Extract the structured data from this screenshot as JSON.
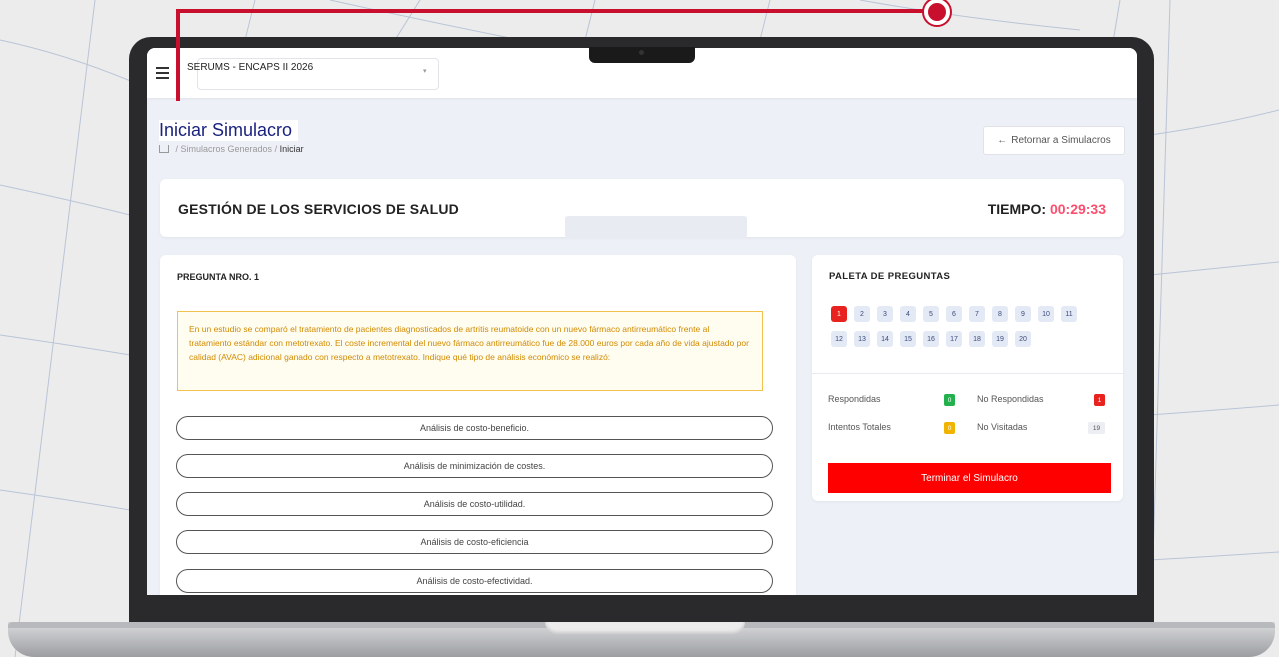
{
  "topbar": {
    "course": "SERUMS - ENCAPS II 2026"
  },
  "header": {
    "title": "Iniciar Simulacro",
    "breadcrumb": [
      "Simulacros Generados",
      "Iniciar"
    ],
    "back_button": "Retornar a Simulacros"
  },
  "exam": {
    "section": "GESTIÓN DE LOS SERVICIOS DE SALUD",
    "timer_label": "TIEMPO:",
    "timer_value": "00:29:33"
  },
  "question": {
    "title": "PREGUNTA NRO. 1",
    "text": "En un estudio se comparó el tratamiento de pacientes diagnosticados de artritis reumatoide con un nuevo fármaco antirreumático frente al tratamiento estándar con metotrexato. El coste incremental del nuevo fármaco antirreumático fue de 28.000 euros por cada año de vida ajustado por calidad (AVAC) adicional ganado con respecto a metotrexato. Indique qué tipo de análisis económico se realizó:",
    "options": [
      "Análisis de costo-beneficio.",
      "Análisis de minimización de costes.",
      "Análisis de costo-utilidad.",
      "Análisis de costo-eficiencia",
      "Análisis de costo-efectividad."
    ]
  },
  "palette": {
    "title": "PALETA DE PREGUNTAS",
    "numbers": [
      "1",
      "2",
      "3",
      "4",
      "5",
      "6",
      "7",
      "8",
      "9",
      "10",
      "11",
      "12",
      "13",
      "14",
      "15",
      "16",
      "17",
      "18",
      "19",
      "20"
    ],
    "current": "1",
    "stats": {
      "answered_label": "Respondidas",
      "answered": "0",
      "unanswered_label": "No Respondidas",
      "unanswered": "1",
      "attempts_label": "Intentos Totales",
      "attempts": "0",
      "unvisited_label": "No Visitadas",
      "unvisited": "19"
    },
    "finish_button": "Terminar el Simulacro"
  },
  "colors": {
    "accent_red": "#e8231f",
    "finish_red": "#ff0000",
    "timer": "#ff4d6d",
    "title_blue": "#1a237e",
    "warning_border": "#f2c14e",
    "answered_green": "#22b14c"
  }
}
